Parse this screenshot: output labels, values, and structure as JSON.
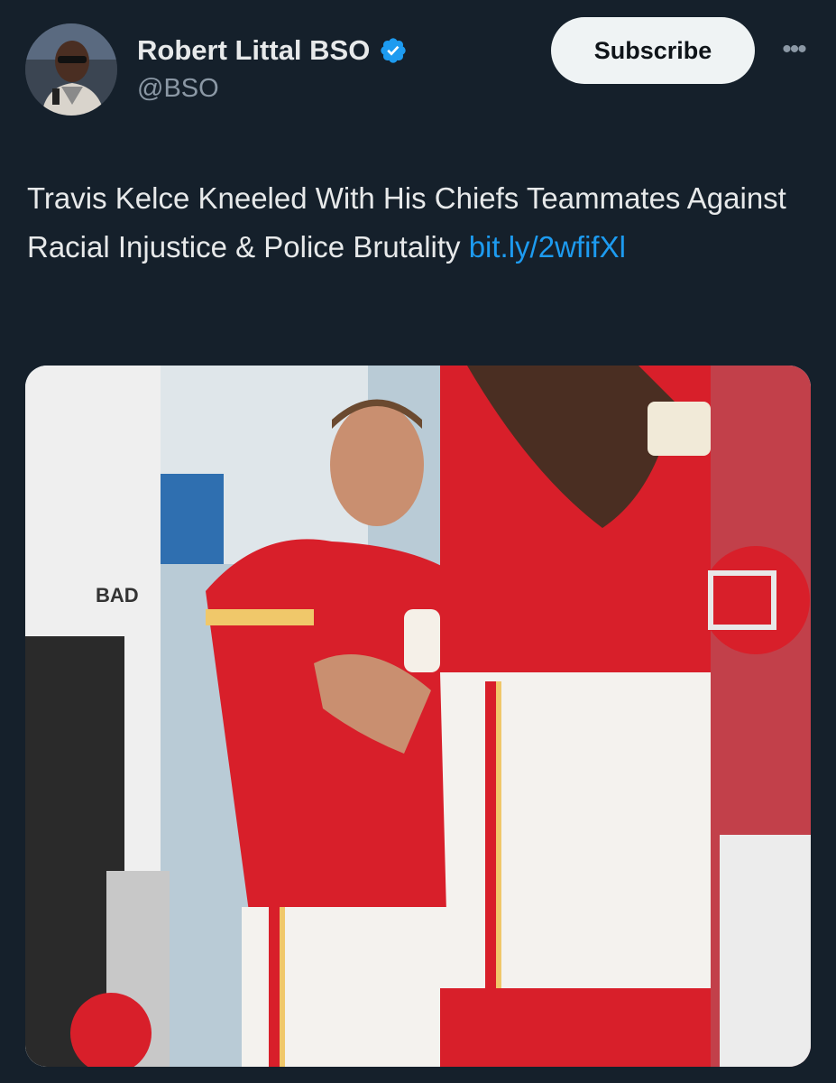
{
  "author": {
    "name": "Robert Littal BSO",
    "handle": "@BSO",
    "verified_icon": "verified-badge-icon",
    "avatar_icon": "avatar-photo"
  },
  "actions": {
    "subscribe_label": "Subscribe",
    "more_icon": "more-horizontal-icon",
    "more_glyph": "•••"
  },
  "post": {
    "text": "Travis Kelce Kneeled With His Chiefs Teammates Against Racial Injustice & Police Brutality",
    "link": "bit.ly/2wfifXl"
  },
  "media": {
    "image_text": "BAD"
  },
  "colors": {
    "background": "#15202b",
    "link": "#1d9bf0",
    "verified": "#1d9bf0",
    "jersey_red": "#d81f2a"
  }
}
